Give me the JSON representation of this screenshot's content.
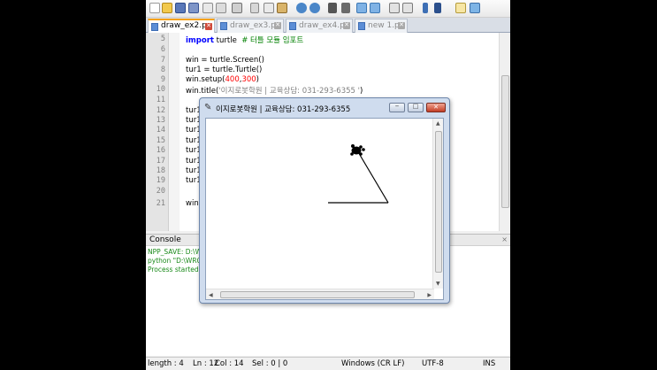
{
  "editor_tabs": [
    {
      "label": "draw_ex2.py",
      "active": true
    },
    {
      "label": "draw_ex3.py",
      "active": false
    },
    {
      "label": "draw_ex4.py",
      "active": false
    },
    {
      "label": "new 1.py",
      "active": false
    }
  ],
  "code": {
    "line_numbers": [
      "5",
      "6",
      "7",
      "8",
      "9",
      "10",
      "11",
      "12",
      "13",
      "14",
      "15",
      "16",
      "17",
      "18",
      "19",
      "20",
      "21"
    ],
    "line5": {
      "keyword": "import",
      "module": " turtle",
      "comment": "  # 터틀 모듈 임포트"
    },
    "line7": "win = turtle.Screen()",
    "line8": "tur1 = turtle.Turtle()",
    "line9": {
      "prefix": "win.setup(",
      "arg1": "400",
      "sep": ",",
      "arg2": "300",
      "suffix": ")"
    },
    "line10": {
      "prefix": "win.title(",
      "str": "'이지로봇학원 | 교육상담: 031-293-6355 '",
      "suffix": ")"
    },
    "hidden_prefix": "tur1",
    "line21": "win"
  },
  "console": {
    "title": "Console",
    "close": "×",
    "lines": [
      "NPP_SAVE: D:\\Wi",
      "python \"D:\\WRO",
      "Process started"
    ]
  },
  "statusbar": {
    "length": "length : 4",
    "ln": "Ln : 12",
    "col": "Col : 14",
    "sel": "Sel : 0 | 0",
    "eol": "Windows (CR LF)",
    "encoding": "UTF-8",
    "mode": "INS"
  },
  "turtle_window": {
    "title": "이지로봇학원 | 교육상담: 031-293-6355",
    "minimize_glyph": "–",
    "maximize_glyph": "□",
    "close_glyph": "✕"
  },
  "colors": {
    "keyword": "#0000ff",
    "comment": "#008000",
    "number": "#ff0000",
    "active_tab_accent": "#f6a21a",
    "turtle": "#000000",
    "console_text": "#1a8a1a"
  },
  "icons": [
    "new-file-icon",
    "open-file-icon",
    "save-icon",
    "save-all-icon",
    "close-icon",
    "close-all-icon",
    "print-icon",
    "cut-icon",
    "copy-icon",
    "paste-icon",
    "undo-icon",
    "redo-icon",
    "find-icon",
    "replace-icon",
    "zoom-in-icon",
    "zoom-out-icon",
    "sync-v-icon",
    "sync-h-icon",
    "wrap-icon",
    "all-chars-icon",
    "indent-guide-icon"
  ]
}
